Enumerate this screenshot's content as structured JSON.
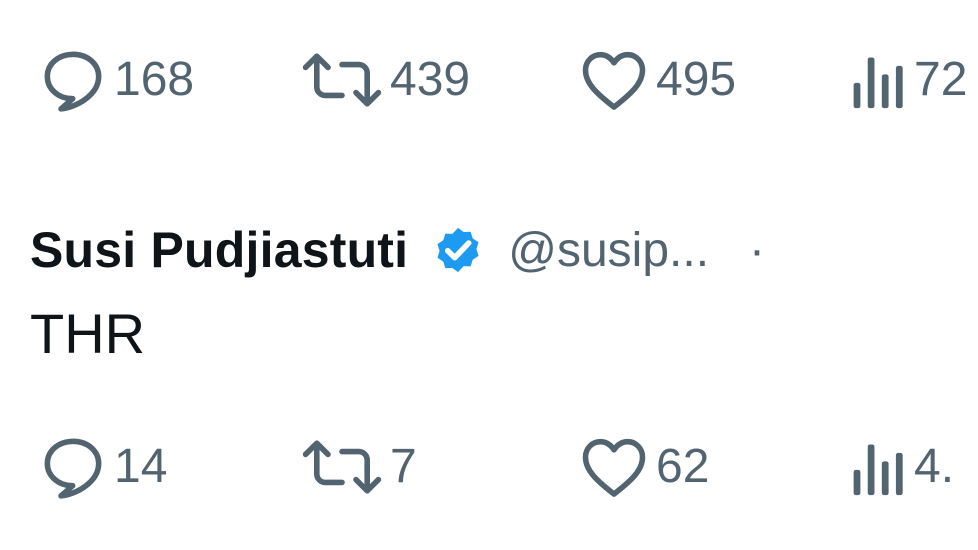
{
  "tweet_prev": {
    "metrics": {
      "replies": "168",
      "retweets": "439",
      "likes": "495",
      "views": "72"
    }
  },
  "tweet": {
    "author_name": "Susi Pudjiastuti",
    "handle": "@susip...",
    "separator": "·",
    "verified": true,
    "text": "THR",
    "metrics": {
      "replies": "14",
      "retweets": "7",
      "likes": "62",
      "views": "4."
    }
  },
  "colors": {
    "accent": "#1d9bf0",
    "muted": "#536471",
    "text": "#0f1419"
  },
  "icons": [
    "reply-icon",
    "retweet-icon",
    "like-icon",
    "views-icon",
    "verified-badge-icon"
  ]
}
